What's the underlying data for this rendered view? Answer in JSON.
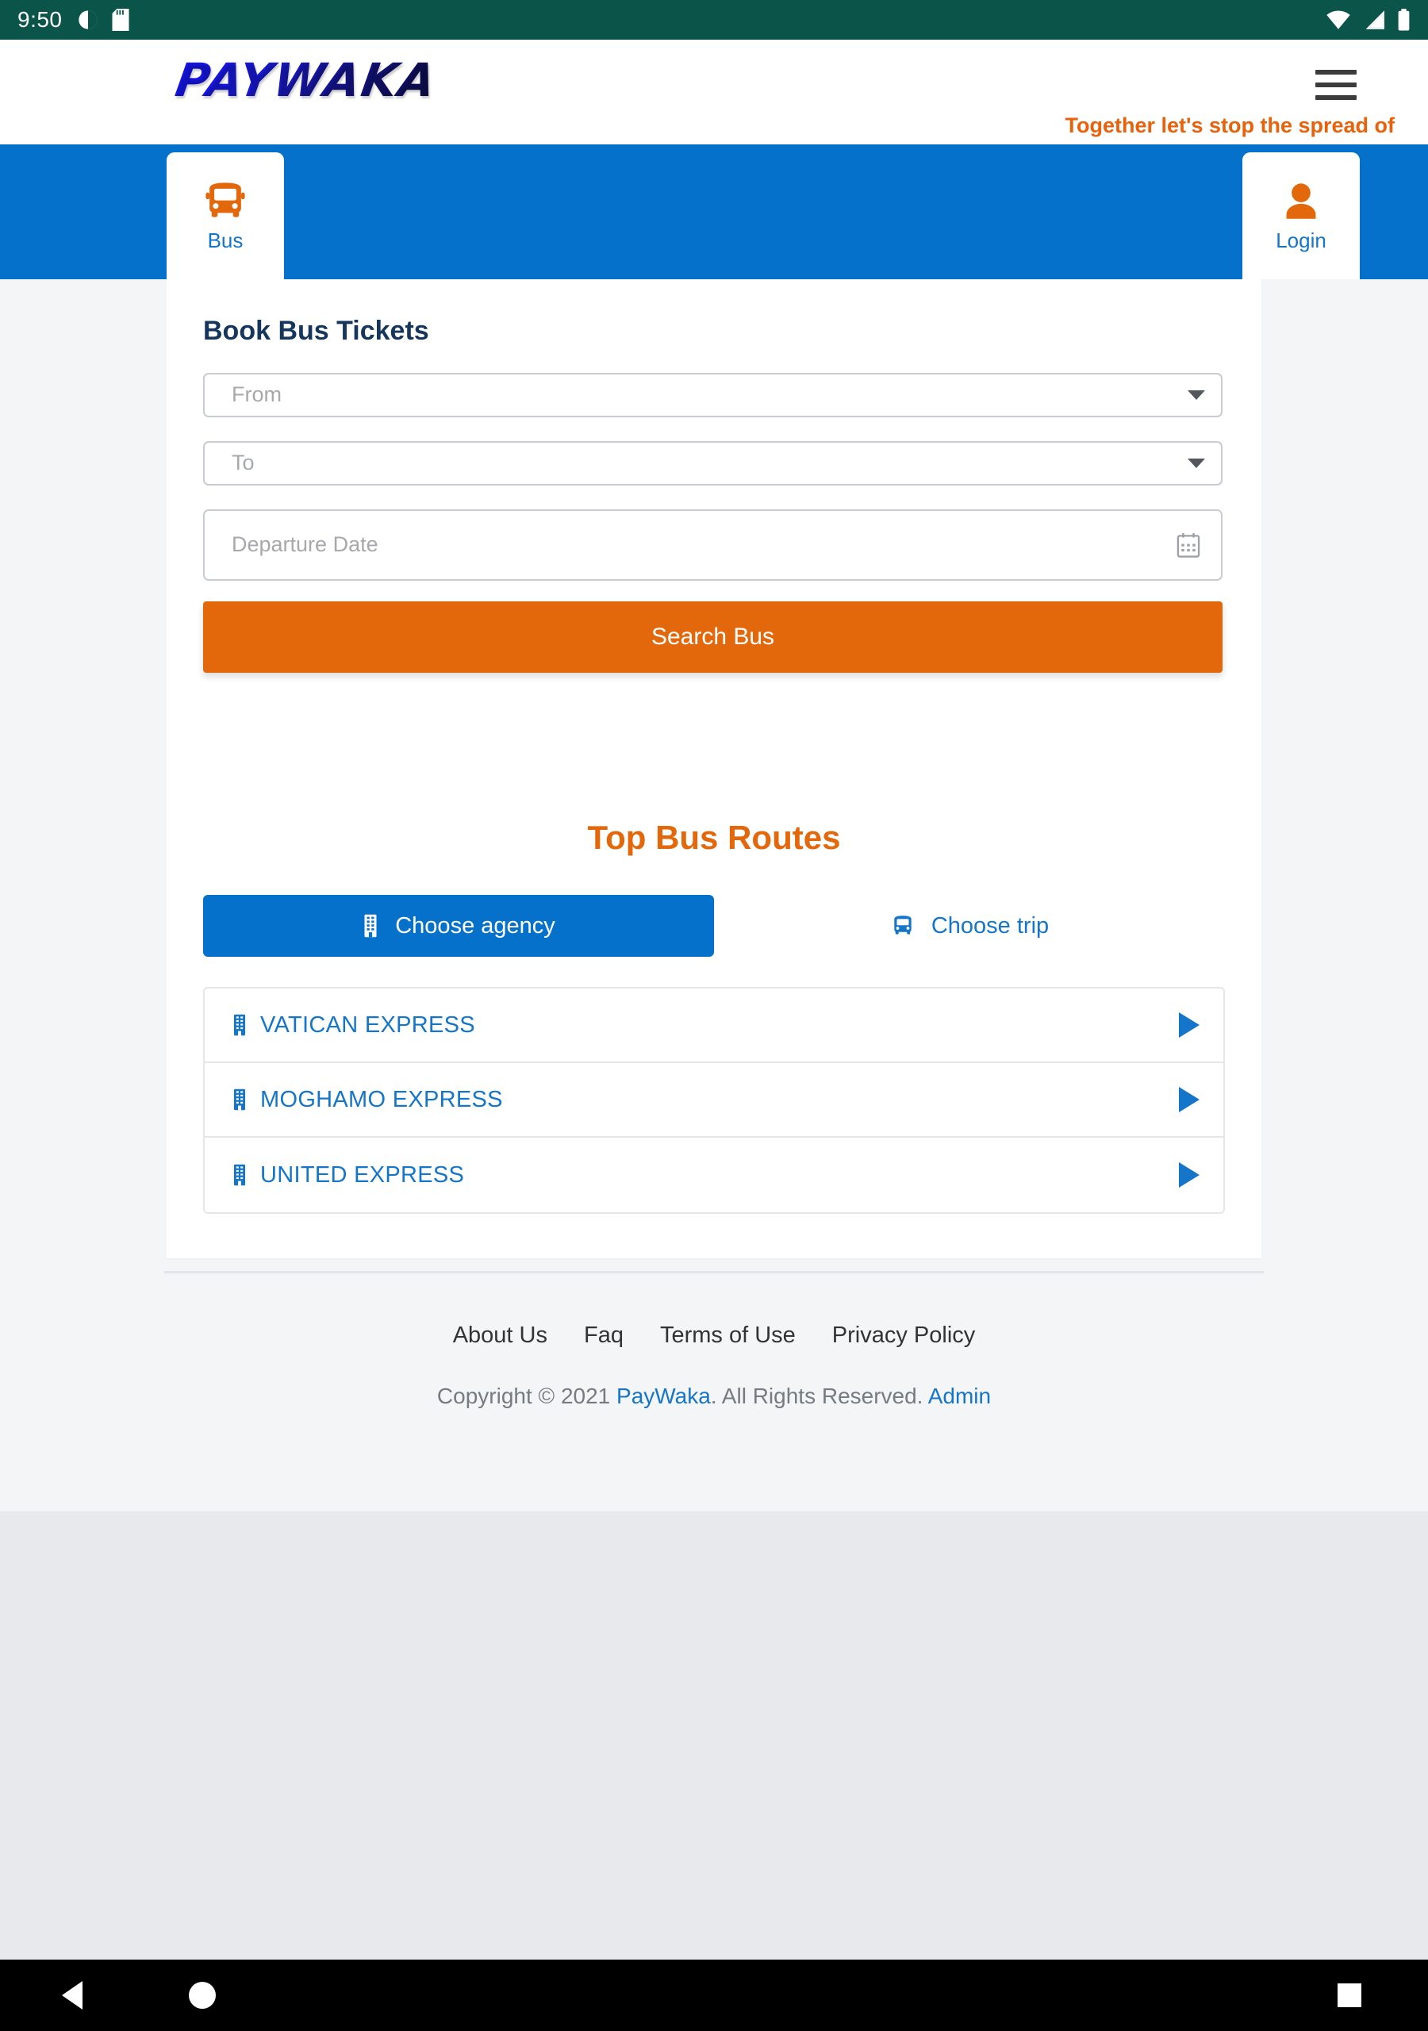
{
  "status_bar": {
    "time": "9:50",
    "icons": [
      "do-not-disturb-icon",
      "sd-card-icon",
      "wifi-icon",
      "cellular-signal-icon",
      "battery-icon"
    ],
    "background_color": "#0b5449"
  },
  "header": {
    "logo_text": "PAYWAKA",
    "menu_icon": "hamburger-menu-icon",
    "marquee_text": "Together let's stop the spread of",
    "marquee_color": "#e8620c"
  },
  "tabs": {
    "accent_color": "#0571cb",
    "items": [
      {
        "label": "Bus",
        "icon": "bus-icon",
        "active": true
      },
      {
        "label": "Login",
        "icon": "user-icon",
        "active": false
      }
    ]
  },
  "booking": {
    "title": "Book Bus Tickets",
    "from": {
      "placeholder": "From",
      "value": ""
    },
    "to": {
      "placeholder": "To",
      "value": ""
    },
    "departure_date": {
      "placeholder": "Departure Date",
      "value": "",
      "icon": "calendar-icon"
    },
    "search_button": "Search Bus",
    "search_button_color": "#e2680b"
  },
  "routes": {
    "title": "Top Bus Routes",
    "title_color": "#e2680b",
    "segments": [
      {
        "label": "Choose agency",
        "icon": "building-icon",
        "active": true
      },
      {
        "label": "Choose trip",
        "icon": "bus-icon",
        "active": false
      }
    ],
    "agencies": [
      {
        "name": "VATICAN EXPRESS",
        "icon": "building-icon",
        "arrow": "play-arrow-icon"
      },
      {
        "name": "MOGHAMO EXPRESS",
        "icon": "building-icon",
        "arrow": "play-arrow-icon"
      },
      {
        "name": "UNITED EXPRESS",
        "icon": "building-icon",
        "arrow": "play-arrow-icon"
      }
    ]
  },
  "footer": {
    "links": [
      "About Us",
      "Faq",
      "Terms of Use",
      "Privacy Policy"
    ],
    "copyright_prefix": "Copyright © 2021 ",
    "brand": "PayWaka",
    "copyright_middle": ". All Rights Reserved. ",
    "admin_link": "Admin"
  },
  "nav_bar": {
    "back_icon": "back-triangle-icon",
    "home_icon": "home-circle-icon",
    "recent_icon": "recents-square-icon"
  }
}
